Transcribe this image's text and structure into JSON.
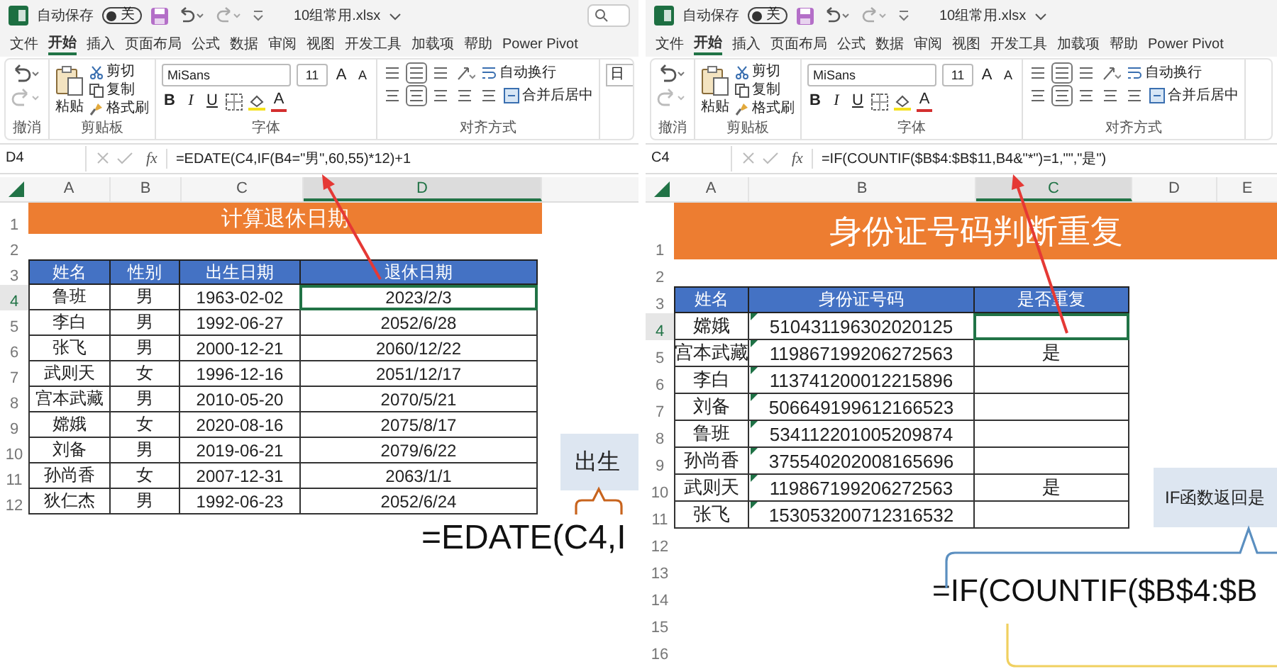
{
  "panels": [
    {
      "title_bar": {
        "autosave_label": "自动保存",
        "autosave_toggle": "关",
        "autosave_on": false,
        "filename": "10组常用.xlsx",
        "search_box": true
      },
      "menu": [
        {
          "label": "文件",
          "selected": false
        },
        {
          "label": "开始",
          "selected": true
        },
        {
          "label": "插入",
          "selected": false
        },
        {
          "label": "页面布局",
          "selected": false
        },
        {
          "label": "公式",
          "selected": false
        },
        {
          "label": "数据",
          "selected": false
        },
        {
          "label": "审阅",
          "selected": false
        },
        {
          "label": "视图",
          "selected": false
        },
        {
          "label": "开发工具",
          "selected": false
        },
        {
          "label": "加载项",
          "selected": false
        },
        {
          "label": "帮助",
          "selected": false
        },
        {
          "label": "Power Pivot",
          "selected": false
        }
      ],
      "ribbon": {
        "undo_label": "撤消",
        "paste": "粘贴",
        "cut": "剪切",
        "copy": "复制",
        "format_painter": "格式刷",
        "clipboard_label": "剪贴板",
        "font_name": "MiSans",
        "font_size": "11",
        "grow": "A",
        "shrink": "A",
        "bold": "B",
        "italic": "I",
        "underline": "U",
        "font_color": "A",
        "font_label": "字体",
        "wrap": "自动换行",
        "merge": "合并后居中",
        "alignment_label": "对齐方式",
        "number_format": "日"
      },
      "formula_bar": {
        "cell": "D4",
        "fx": "fx",
        "formula": "=EDATE(C4,IF(B4=\"男\",60,55)*12)+1"
      },
      "sheet": {
        "columns": [
          {
            "label": "A",
            "selected": false
          },
          {
            "label": "B",
            "selected": false
          },
          {
            "label": "C",
            "selected": false
          },
          {
            "label": "D",
            "selected": true
          }
        ],
        "row_numbers": [
          "1",
          "2",
          "3",
          "4",
          "5",
          "6",
          "7",
          "8",
          "9",
          "10",
          "11",
          "12"
        ],
        "title": "计算退休日期",
        "header": [
          "姓名",
          "性别",
          "出生日期",
          "退休日期"
        ],
        "rows": [
          {
            "cells": [
              "鲁班",
              "男",
              "1963-02-02",
              "2023/2/3"
            ],
            "selected": true,
            "number_as_text": false
          },
          {
            "cells": [
              "李白",
              "男",
              "1992-06-27",
              "2052/6/28"
            ],
            "selected": false,
            "number_as_text": false
          },
          {
            "cells": [
              "张飞",
              "男",
              "2000-12-21",
              "2060/12/22"
            ],
            "selected": false,
            "number_as_text": false
          },
          {
            "cells": [
              "武则天",
              "女",
              "1996-12-16",
              "2051/12/17"
            ],
            "selected": false,
            "number_as_text": false
          },
          {
            "cells": [
              "宫本武藏",
              "男",
              "2010-05-20",
              "2070/5/21"
            ],
            "selected": false,
            "number_as_text": false
          },
          {
            "cells": [
              "嫦娥",
              "女",
              "2020-08-16",
              "2075/8/17"
            ],
            "selected": false,
            "number_as_text": false
          },
          {
            "cells": [
              "刘备",
              "男",
              "2019-06-21",
              "2079/6/22"
            ],
            "selected": false,
            "number_as_text": false
          },
          {
            "cells": [
              "孙尚香",
              "女",
              "2007-12-31",
              "2063/1/1"
            ],
            "selected": false,
            "number_as_text": false
          },
          {
            "cells": [
              "狄仁杰",
              "男",
              "1992-06-23",
              "2052/6/24"
            ],
            "selected": false,
            "number_as_text": false
          }
        ]
      },
      "callout": "出生",
      "big_formula": "=EDATE(C4,I"
    },
    {
      "title_bar": {
        "autosave_label": "自动保存",
        "autosave_toggle": "关",
        "autosave_on": false,
        "filename": "10组常用.xlsx",
        "search_box": false
      },
      "menu": [
        {
          "label": "文件",
          "selected": false
        },
        {
          "label": "开始",
          "selected": true
        },
        {
          "label": "插入",
          "selected": false
        },
        {
          "label": "页面布局",
          "selected": false
        },
        {
          "label": "公式",
          "selected": false
        },
        {
          "label": "数据",
          "selected": false
        },
        {
          "label": "审阅",
          "selected": false
        },
        {
          "label": "视图",
          "selected": false
        },
        {
          "label": "开发工具",
          "selected": false
        },
        {
          "label": "加载项",
          "selected": false
        },
        {
          "label": "帮助",
          "selected": false
        },
        {
          "label": "Power Pivot",
          "selected": false
        }
      ],
      "ribbon": {
        "undo_label": "撤消",
        "paste": "粘贴",
        "cut": "剪切",
        "copy": "复制",
        "format_painter": "格式刷",
        "clipboard_label": "剪贴板",
        "font_name": "MiSans",
        "font_size": "11",
        "grow": "A",
        "shrink": "A",
        "bold": "B",
        "italic": "I",
        "underline": "U",
        "font_color": "A",
        "font_label": "字体",
        "wrap": "自动换行",
        "merge": "合并后居中",
        "alignment_label": "对齐方式"
      },
      "formula_bar": {
        "cell": "C4",
        "fx": "fx",
        "formula": "=IF(COUNTIF($B$4:$B$11,B4&\"*\")=1,\"\",\"是\")"
      },
      "sheet": {
        "columns": [
          {
            "label": "A",
            "selected": false
          },
          {
            "label": "B",
            "selected": false
          },
          {
            "label": "C",
            "selected": true
          },
          {
            "label": "D",
            "selected": false
          },
          {
            "label": "E",
            "selected": false
          }
        ],
        "row_numbers": [
          "1",
          "2",
          "3",
          "4",
          "5",
          "6",
          "7",
          "8",
          "9",
          "10",
          "11",
          "12",
          "13",
          "14",
          "15",
          "16"
        ],
        "title": "身份证号码判断重复",
        "header": [
          "姓名",
          "身份证号码",
          "是否重复"
        ],
        "rows": [
          {
            "cells": [
              "嫦娥",
              "510431196302020125"
            ],
            "selected": true,
            "number_as_text": true
          },
          {
            "cells": [
              "宫本武藏",
              "119867199206272563",
              "是"
            ],
            "selected": false,
            "number_as_text": true
          },
          {
            "cells": [
              "李白",
              "113741200012215896"
            ],
            "selected": false,
            "number_as_text": true
          },
          {
            "cells": [
              "刘备",
              "506649199612166523"
            ],
            "selected": false,
            "number_as_text": true
          },
          {
            "cells": [
              "鲁班",
              "534112201005209874"
            ],
            "selected": false,
            "number_as_text": true
          },
          {
            "cells": [
              "孙尚香",
              "375540202008165696"
            ],
            "selected": false,
            "number_as_text": true
          },
          {
            "cells": [
              "武则天",
              "119867199206272563",
              "是"
            ],
            "selected": false,
            "number_as_text": true
          },
          {
            "cells": [
              "张飞",
              "153053200712316532"
            ],
            "selected": false,
            "number_as_text": true
          }
        ]
      },
      "callout": "IF函数返回是",
      "big_formula": "=IF(COUNTIF($B$4:$B"
    }
  ]
}
